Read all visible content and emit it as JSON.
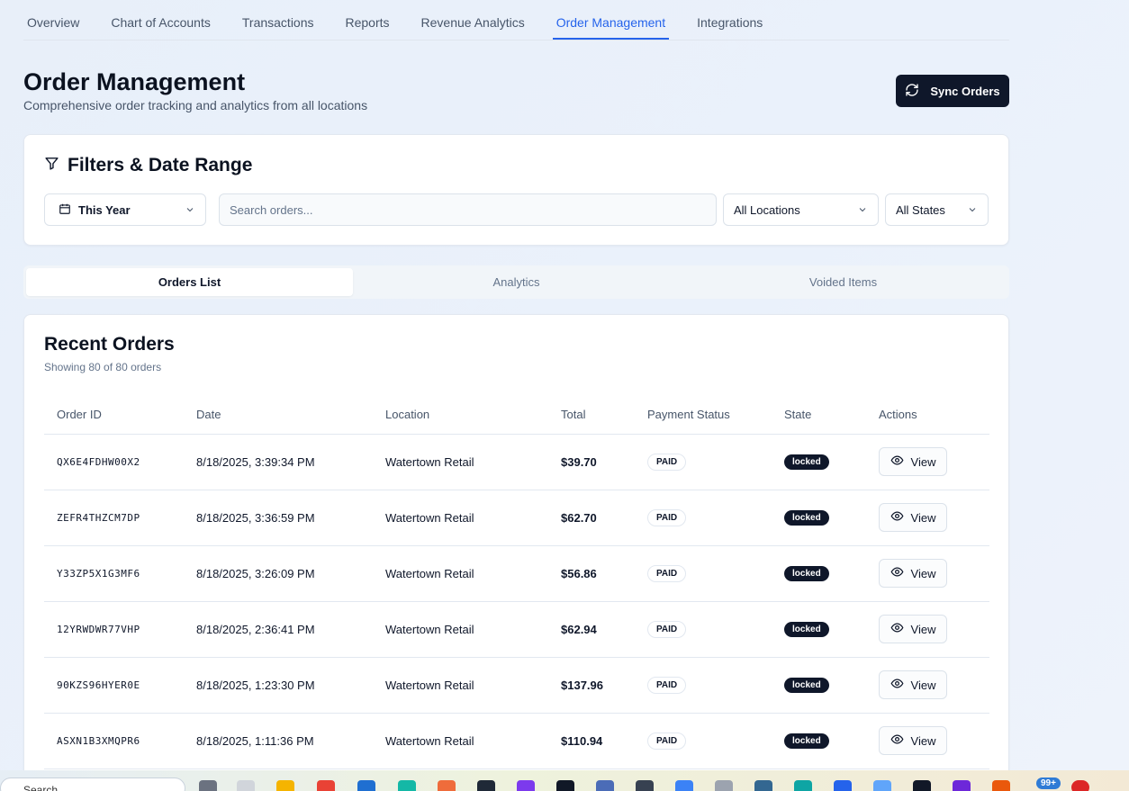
{
  "nav": {
    "tabs": [
      {
        "label": "Overview"
      },
      {
        "label": "Chart of Accounts"
      },
      {
        "label": "Transactions"
      },
      {
        "label": "Reports"
      },
      {
        "label": "Revenue Analytics"
      },
      {
        "label": "Order Management",
        "active": true
      },
      {
        "label": "Integrations"
      }
    ]
  },
  "header": {
    "title": "Order Management",
    "subtitle": "Comprehensive order tracking and analytics from all locations",
    "sync_label": "Sync Orders"
  },
  "filters": {
    "title": "Filters & Date Range",
    "date_range": "This Year",
    "search_placeholder": "Search orders...",
    "search_value": "",
    "location": "All Locations",
    "state": "All States"
  },
  "subtabs": [
    {
      "label": "Orders List",
      "active": true
    },
    {
      "label": "Analytics"
    },
    {
      "label": "Voided Items"
    }
  ],
  "orders": {
    "title": "Recent Orders",
    "subtitle": "Showing 80 of 80 orders",
    "columns": [
      "Order ID",
      "Date",
      "Location",
      "Total",
      "Payment Status",
      "State",
      "Actions"
    ],
    "rows": [
      {
        "id": "QX6E4FDHW00X2",
        "date": "8/18/2025, 3:39:34 PM",
        "location": "Watertown Retail",
        "total": "$39.70",
        "payment": "PAID",
        "state": "locked",
        "action": "View"
      },
      {
        "id": "ZEFR4THZCM7DP",
        "date": "8/18/2025, 3:36:59 PM",
        "location": "Watertown Retail",
        "total": "$62.70",
        "payment": "PAID",
        "state": "locked",
        "action": "View"
      },
      {
        "id": "Y33ZP5X1G3MF6",
        "date": "8/18/2025, 3:26:09 PM",
        "location": "Watertown Retail",
        "total": "$56.86",
        "payment": "PAID",
        "state": "locked",
        "action": "View"
      },
      {
        "id": "12YRWDWR77VHP",
        "date": "8/18/2025, 2:36:41 PM",
        "location": "Watertown Retail",
        "total": "$62.94",
        "payment": "PAID",
        "state": "locked",
        "action": "View"
      },
      {
        "id": "90KZS96HYER0E",
        "date": "8/18/2025, 1:23:30 PM",
        "location": "Watertown Retail",
        "total": "$137.96",
        "payment": "PAID",
        "state": "locked",
        "action": "View"
      },
      {
        "id": "ASXN1B3XMQPR6",
        "date": "8/18/2025, 1:11:36 PM",
        "location": "Watertown Retail",
        "total": "$110.94",
        "payment": "PAID",
        "state": "locked",
        "action": "View"
      }
    ]
  },
  "taskbar": {
    "search_label": "Search",
    "badge": "99+"
  },
  "colors": {
    "accent": "#2563eb",
    "primary_dark": "#0f172a",
    "muted_text": "#64748b"
  }
}
